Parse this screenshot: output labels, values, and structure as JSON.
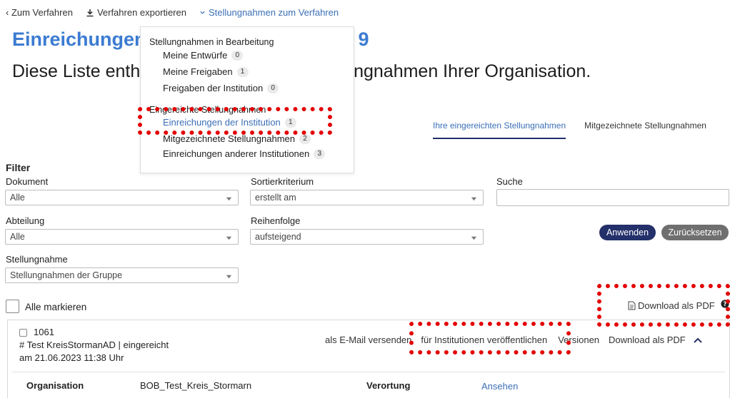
{
  "topnav": {
    "back": "‹ Zum Verfahren",
    "export": "Verfahren exportieren",
    "statements": "Stellungnahmen zum Verfahren"
  },
  "page": {
    "title": "Einreichungen der Institution - Sprint 9",
    "subtitle": "Diese Liste enthält alle eingereichten Stellungnahmen Ihrer Organisation."
  },
  "dropdown": {
    "section1": "Stellungnahmen in Bearbeitung",
    "items1": [
      {
        "label": "Meine Entwürfe",
        "count": "0"
      },
      {
        "label": "Meine Freigaben",
        "count": "1"
      },
      {
        "label": "Freigaben der Institution",
        "count": "0"
      }
    ],
    "section2": "Eingereichte Stellungnahmen",
    "items2": [
      {
        "label": "Einreichungen der Institution",
        "count": "1"
      },
      {
        "label": "Mitgezeichnete Stellungnahmen",
        "count": "2"
      },
      {
        "label": "Einreichungen anderer Institutionen",
        "count": "3"
      }
    ]
  },
  "tabs": {
    "own": "Ihre eingereichten Stellungnahmen",
    "cosigned": "Mitgezeichnete Stellungnahmen"
  },
  "filter": {
    "title": "Filter",
    "document_label": "Dokument",
    "document_value": "Alle",
    "sort_label": "Sortierkriterium",
    "sort_value": "erstellt am",
    "search_label": "Suche",
    "department_label": "Abteilung",
    "department_value": "Alle",
    "order_label": "Reihenfolge",
    "order_value": "aufsteigend",
    "statement_label": "Stellungnahme",
    "statement_value": "Stellungnahmen der Gruppe",
    "apply": "Anwenden",
    "reset": "Zurücksetzen"
  },
  "list": {
    "select_all": "Alle markieren",
    "download_pdf": "Download als PDF"
  },
  "card": {
    "id": "1061",
    "name_line": "# Test KreisStormanAD | eingereicht",
    "date_line": "am 21.06.2023 11:38 Uhr",
    "actions": {
      "email": "als E-Mail versenden",
      "publish": "für Institutionen veröffentlichen",
      "versions": "Versionen",
      "pdf": "Download als PDF"
    },
    "org_label": "Organisation",
    "org_value": "BOB_Test_Kreis_Stormarn",
    "location_label": "Verortung",
    "location_link": "Ansehen"
  },
  "colors": {
    "accent": "#3b6fb6",
    "title": "#3b7bd1",
    "primary_button": "#23306a",
    "secondary_button": "#6f6f6f",
    "highlight": "#e30000"
  }
}
